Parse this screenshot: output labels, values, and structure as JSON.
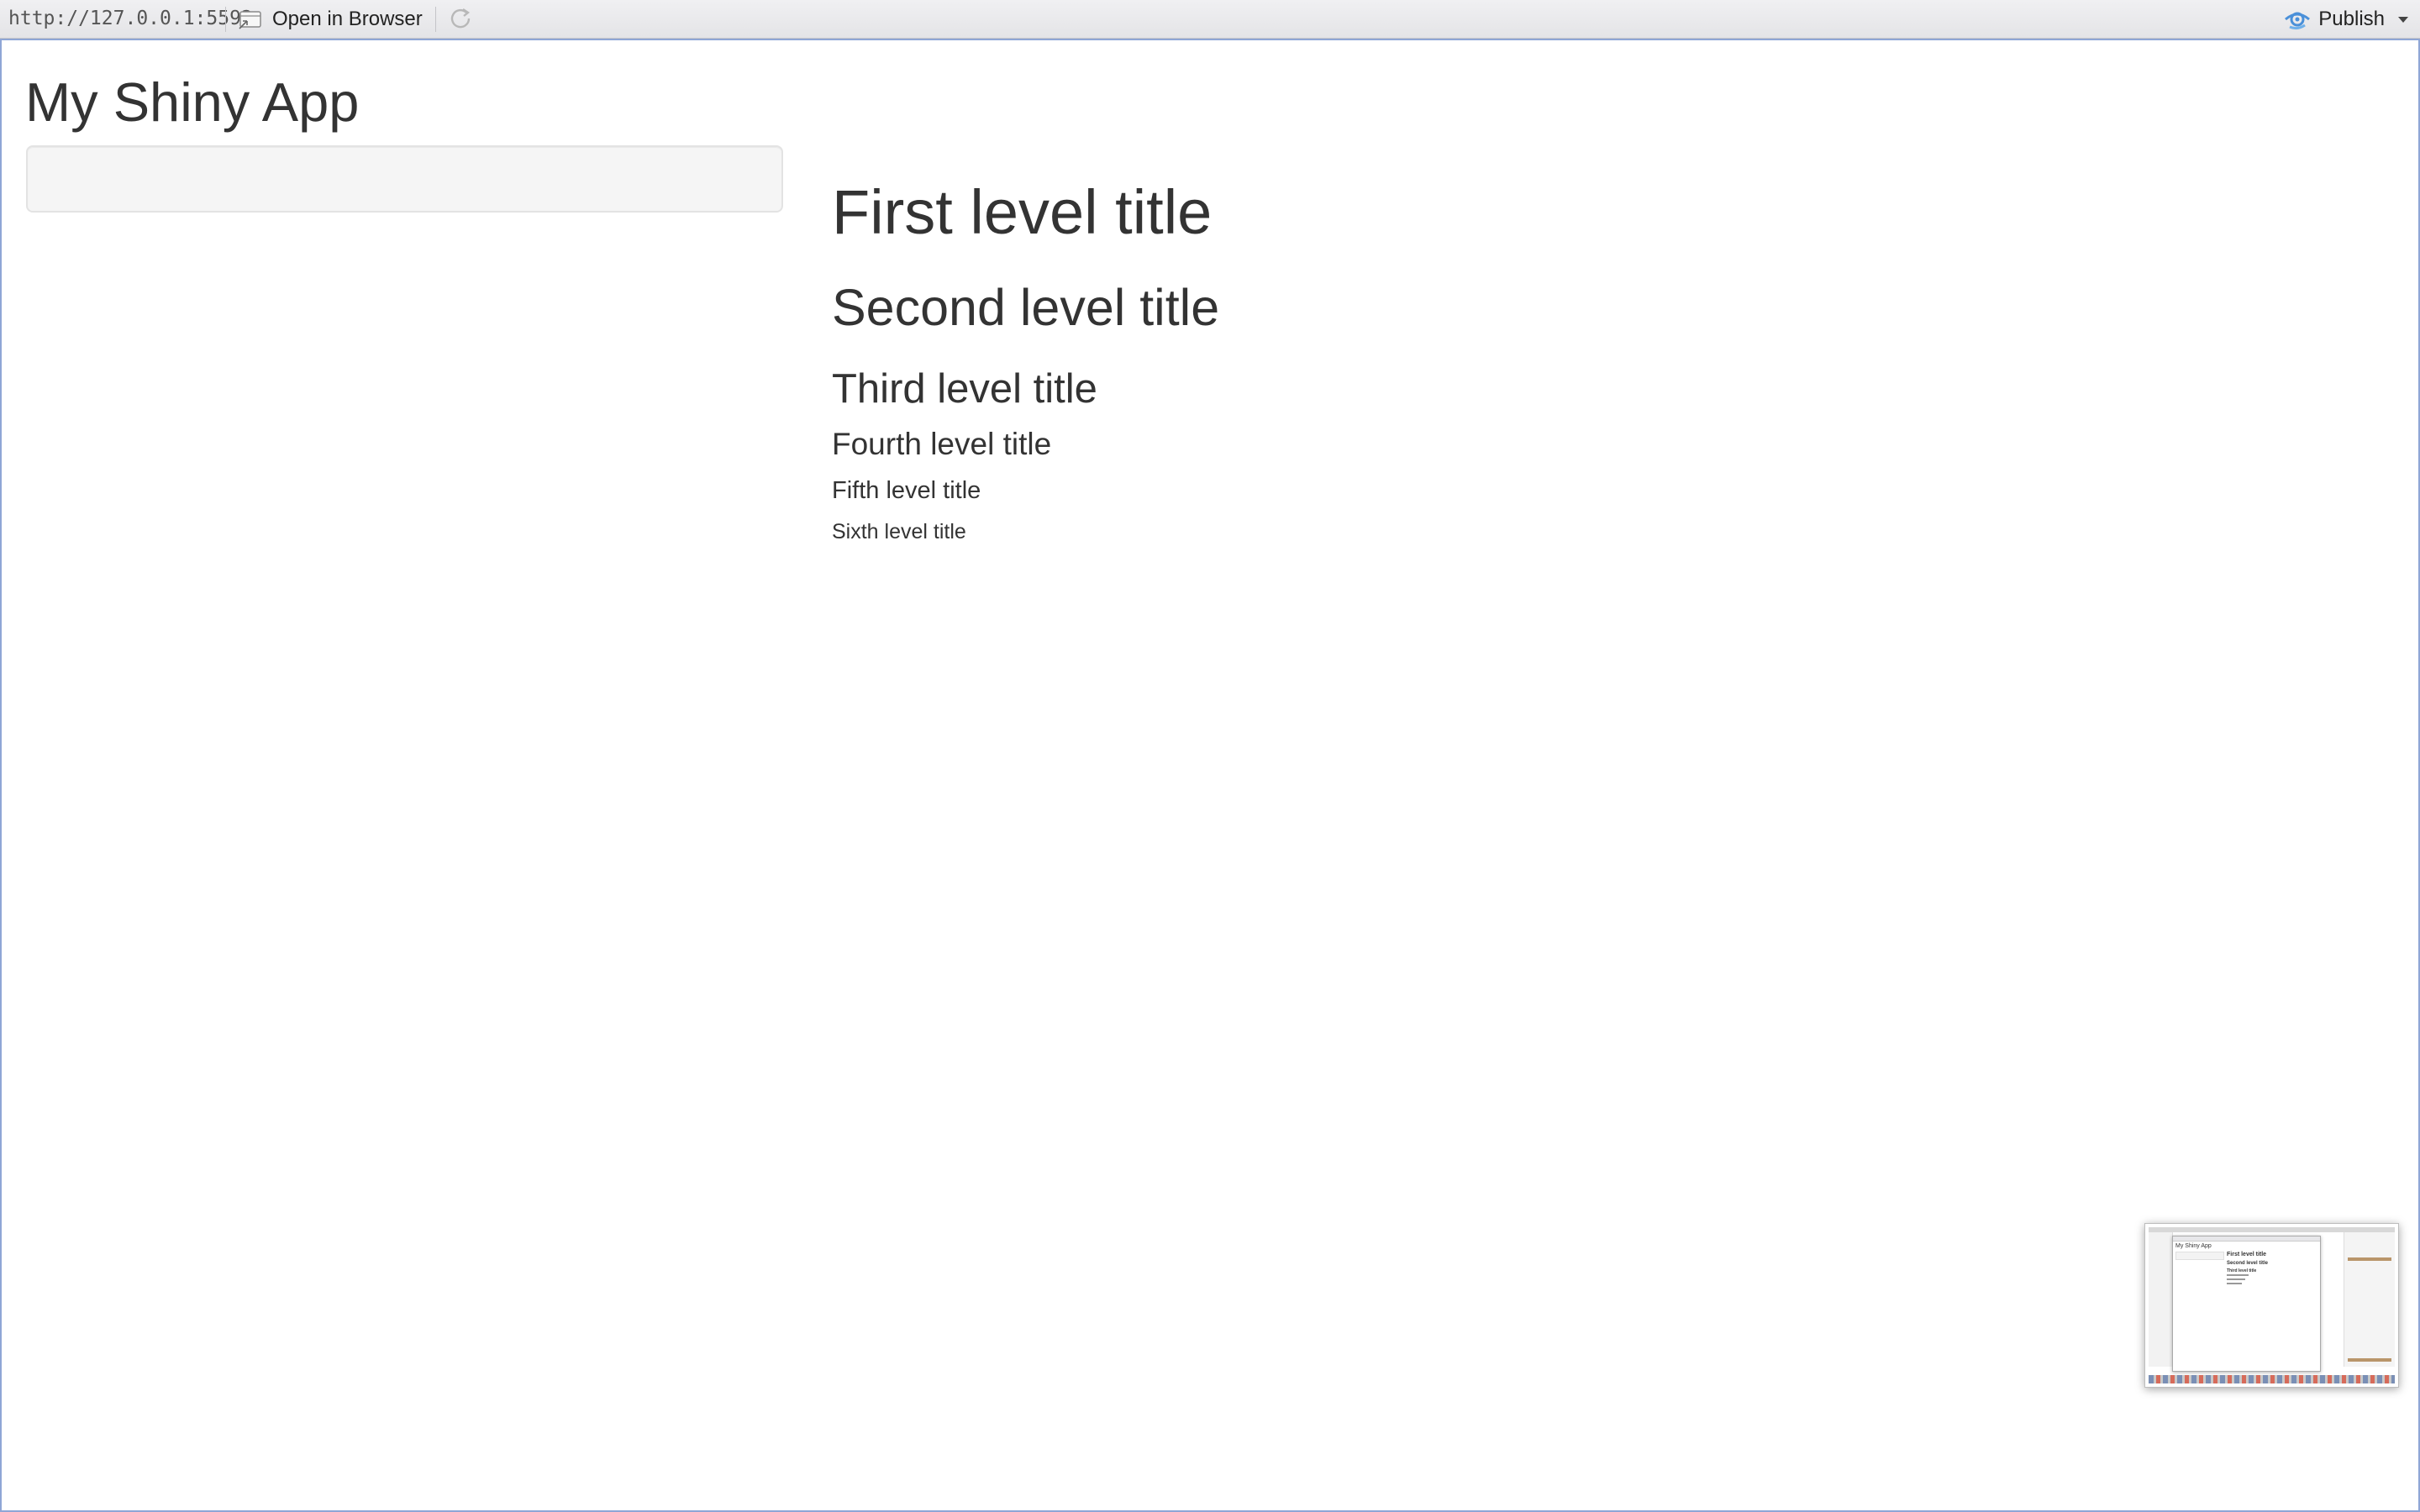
{
  "toolbar": {
    "url": "http://127.0.0.1:5592",
    "open_in_browser_label": "Open in Browser",
    "open_in_browser_icon": "open-in-browser-icon",
    "refresh_icon": "refresh-icon",
    "publish_label": "Publish",
    "publish_icon": "publish-icon",
    "publish_menu_icon": "chevron-down-icon",
    "publish_icon_color": "#4a90d9"
  },
  "app": {
    "title": "My Shiny App"
  },
  "main": {
    "headings": {
      "h1": "First level title",
      "h2": "Second level title",
      "h3": "Third level title",
      "h4": "Fourth level title",
      "h5": "Fifth level title",
      "h6": "Sixth level title"
    }
  },
  "thumbnail": {
    "title": "My Shiny App",
    "h1": "First level title",
    "h2": "Second level title",
    "h3": "Third level title"
  },
  "colors": {
    "text": "#333333",
    "sidebar_background": "#f5f5f5",
    "sidebar_border": "#e3e3e3",
    "frame_border": "#8fa6d6"
  }
}
